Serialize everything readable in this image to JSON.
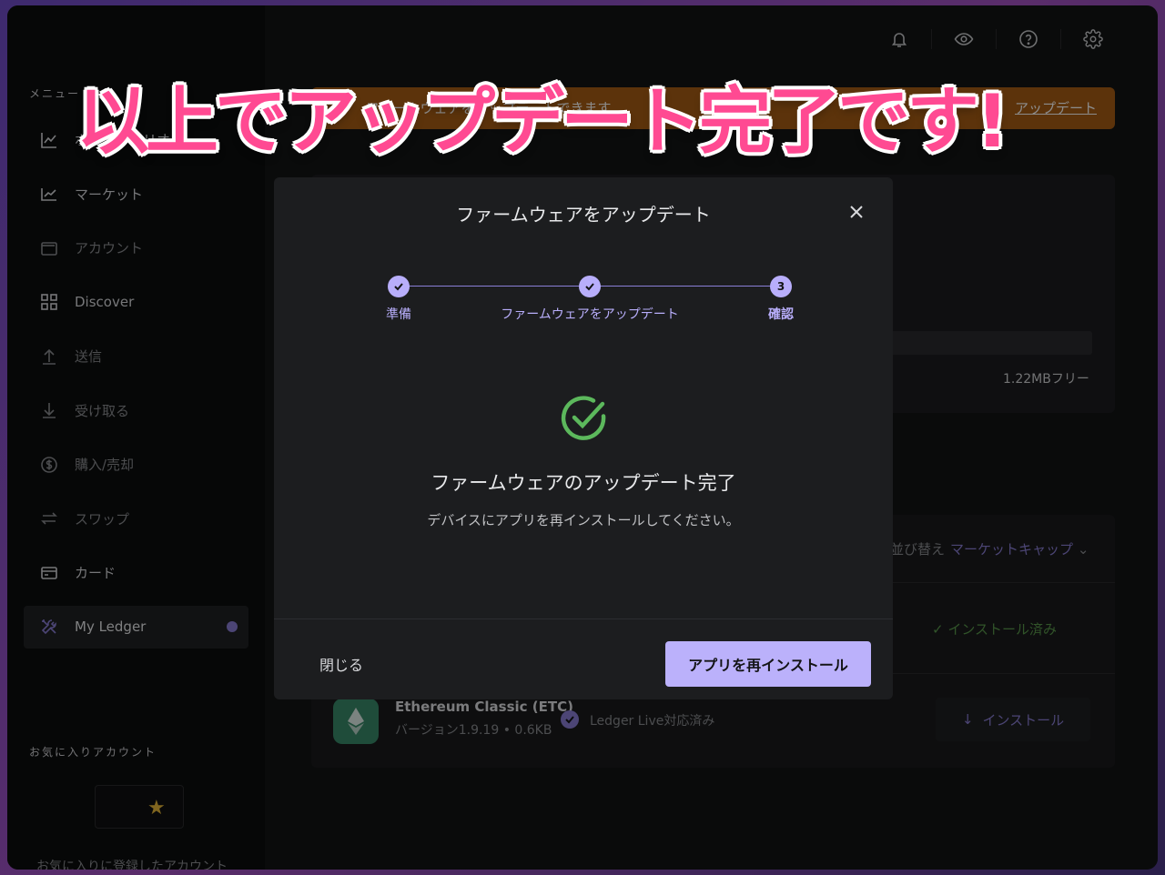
{
  "sidebar": {
    "menu_label": "メニュー",
    "items": [
      {
        "label": "ポートフォリオ",
        "icon": "chart-line-icon",
        "state": "bright"
      },
      {
        "label": "マーケット",
        "icon": "trend-up-icon",
        "state": "bright"
      },
      {
        "label": "アカウント",
        "icon": "wallet-icon",
        "state": "dim"
      },
      {
        "label": "Discover",
        "icon": "grid-icon",
        "state": "bright"
      },
      {
        "label": "送信",
        "icon": "arrow-up-icon",
        "state": "dim"
      },
      {
        "label": "受け取る",
        "icon": "arrow-down-icon",
        "state": "dim"
      },
      {
        "label": "購入/売却",
        "icon": "dollar-circle-icon",
        "state": "dim"
      },
      {
        "label": "スワップ",
        "icon": "swap-icon",
        "state": "dim"
      },
      {
        "label": "カード",
        "icon": "card-icon",
        "state": "bright"
      },
      {
        "label": "My Ledger",
        "icon": "tools-icon",
        "state": "active"
      }
    ],
    "favorites_label": "お気に入りアカウント",
    "favorites_hint": "お気に入りに登録したアカウント"
  },
  "top_icons": [
    "bell-icon",
    "eye-icon",
    "help-icon",
    "gear-icon"
  ],
  "banner": {
    "text": "ファームウェアをアップデートできます",
    "link": "アップデート"
  },
  "background": {
    "storage_free": "1.22MBフリー",
    "sort_label": "並び替え",
    "sort_value": "マーケットキャップ",
    "installed_label": "インストール済み",
    "app": {
      "name": "Ethereum Classic (ETC)",
      "version": "バージョン1.9.19 • 0.6KB",
      "support": "Ledger Live対応済み",
      "install_label": "インストール"
    }
  },
  "modal": {
    "title": "ファームウェアをアップデート",
    "steps": [
      {
        "label": "準備",
        "state": "done"
      },
      {
        "label": "ファームウェアをアップデート",
        "state": "done"
      },
      {
        "label": "確認",
        "state": "current",
        "number": "3"
      }
    ],
    "success_title": "ファームウェアのアップデート完了",
    "success_desc": "デバイスにアプリを再インストールしてください。",
    "close_label": "閉じる",
    "primary_label": "アプリを再インストール"
  },
  "headline": "以上でアップデート完了です!",
  "colors": {
    "accent": "#bbb1fb",
    "success": "#5cb85c",
    "banner": "#a85e14",
    "headline": "#ff4a92"
  }
}
